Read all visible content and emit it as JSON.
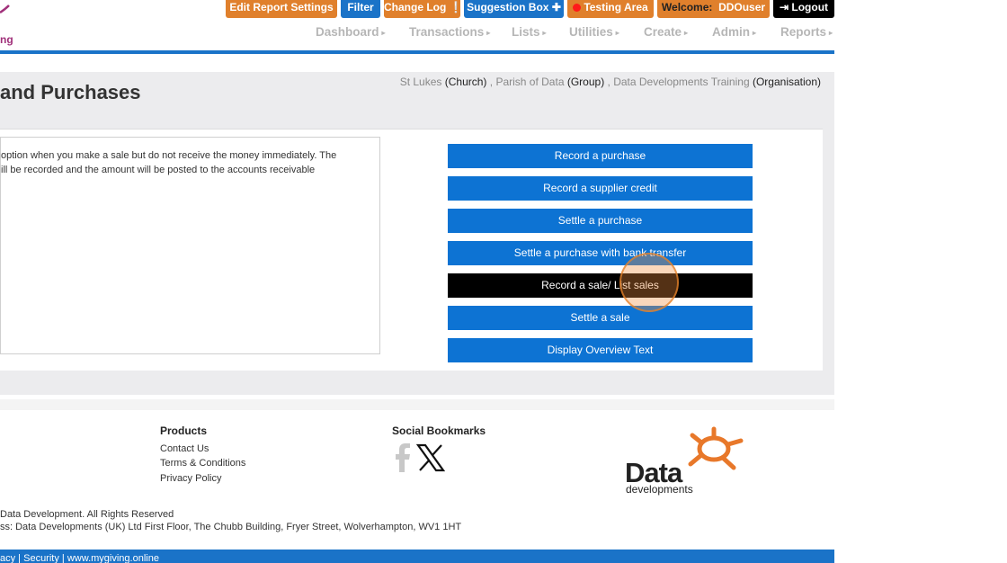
{
  "topbar": {
    "edit_report_settings": "Edit Report Settings",
    "filter": "Filter",
    "change_log": "Change Log",
    "suggestion_box": "Suggestion Box",
    "testing_area": "Testing Area",
    "welcome_label": "Welcome:",
    "welcome_user": "DDOuser",
    "logout": "Logout"
  },
  "brand_fragment": "ng",
  "nav": {
    "items": [
      "Dashboard",
      "Transactions",
      "Lists",
      "Utilities",
      "Create",
      "Admin",
      "Reports"
    ]
  },
  "breadcrumb": {
    "church": "St Lukes",
    "church_type": "(Church)",
    "parish": "Parish of Data",
    "parish_type": "(Group)",
    "org": "Data Developments Training",
    "org_type": "(Organisation)"
  },
  "page_title": "and Purchases",
  "description": {
    "line1": "option when you make a sale but do not receive the money immediately. The",
    "line2": "ill be recorded and the amount will be posted to the accounts receivable"
  },
  "actions": [
    "Record a purchase",
    "Record a supplier credit",
    "Settle a purchase",
    "Settle a purchase with bank transfer",
    "Record a sale/ List sales",
    "Settle a sale",
    "Display Overview Text"
  ],
  "footer": {
    "products_heading": "Products",
    "links": [
      "Contact Us",
      "Terms & Conditions",
      "Privacy Policy"
    ],
    "social_heading": "Social Bookmarks",
    "copyright": "Data Development. All Rights Reserved",
    "address": "ss: Data Developments (UK) Ltd First Floor, The Chubb Building, Fryer Street, Wolverhampton, WV1 1HT",
    "logo_main": "Data",
    "logo_sub": "developments",
    "bottom_links": [
      "acy",
      "Security",
      "www.mygiving.online"
    ]
  },
  "colors": {
    "primary_blue": "#1a73c8",
    "orange": "#e0802c",
    "active_button": "#000000"
  }
}
